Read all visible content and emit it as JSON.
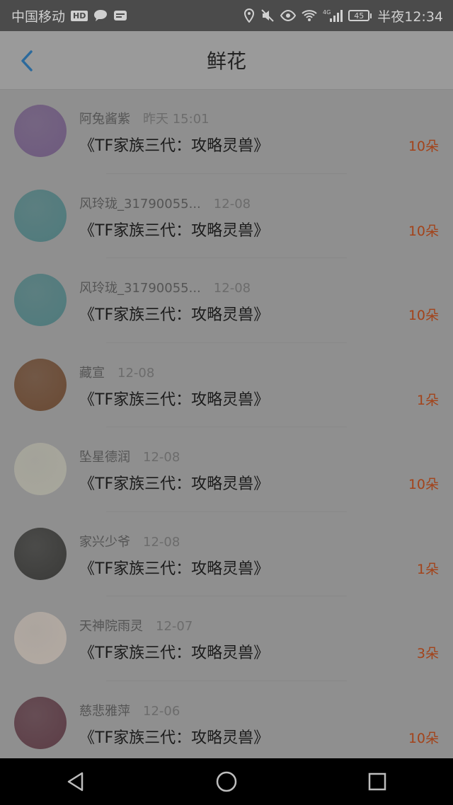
{
  "status_bar": {
    "carrier": "中国移动",
    "hd_badge": "HD",
    "battery": "45",
    "time": "半夜12:34",
    "network": "4G"
  },
  "header": {
    "title": "鲜花",
    "back_icon": "chevron-left-icon"
  },
  "list": [
    {
      "name": "阿兔酱紫",
      "time": "昨天 15:01",
      "book": "《TF家族三代：攻略灵兽》",
      "amount": "10朵",
      "avatar_color": "#6e5a7e"
    },
    {
      "name": "风玲珑_31790055...",
      "time": "12-08",
      "book": "《TF家族三代：攻略灵兽》",
      "amount": "10朵",
      "avatar_color": "#4f7a7c"
    },
    {
      "name": "风玲珑_31790055...",
      "time": "12-08",
      "book": "《TF家族三代：攻略灵兽》",
      "amount": "10朵",
      "avatar_color": "#4f7a7c"
    },
    {
      "name": "藏宣",
      "time": "12-08",
      "book": "《TF家族三代：攻略灵兽》",
      "amount": "1朵",
      "avatar_color": "#6a4a34"
    },
    {
      "name": "坠星德润",
      "time": "12-08",
      "book": "《TF家族三代：攻略灵兽》",
      "amount": "10朵",
      "avatar_color": "#a8a79c"
    },
    {
      "name": "家兴少爷",
      "time": "12-08",
      "book": "《TF家族三代：攻略灵兽》",
      "amount": "1朵",
      "avatar_color": "#3a3a38"
    },
    {
      "name": "天神院雨灵",
      "time": "12-07",
      "book": "《TF家族三代：攻略灵兽》",
      "amount": "3朵",
      "avatar_color": "#b3aaa2"
    },
    {
      "name": "慈悲雅萍",
      "time": "12-06",
      "book": "《TF家族三代：攻略灵兽》",
      "amount": "10朵",
      "avatar_color": "#5c3d46"
    }
  ],
  "android_nav": {
    "back_icon": "triangle-back-icon",
    "home_icon": "circle-home-icon",
    "recents_icon": "square-recents-icon"
  }
}
